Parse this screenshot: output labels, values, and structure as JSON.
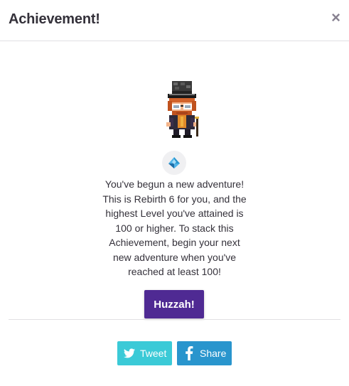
{
  "dialog": {
    "title": "Achievement!",
    "close_symbol": "×"
  },
  "achievement": {
    "icon": "rebirth-icon",
    "description": "You've begun a new adventure! This is Rebirth 6 for you, and the highest Level you've attained is 100 or higher. To stack this Achievement, begin your next new adventure when you've reached at least 100!"
  },
  "actions": {
    "confirm_label": "Huzzah!",
    "tweet_label": "Tweet",
    "share_label": "Share"
  },
  "colors": {
    "confirm": "#4f2a93",
    "tweet": "#3bcad7",
    "share": "#2995cd"
  }
}
